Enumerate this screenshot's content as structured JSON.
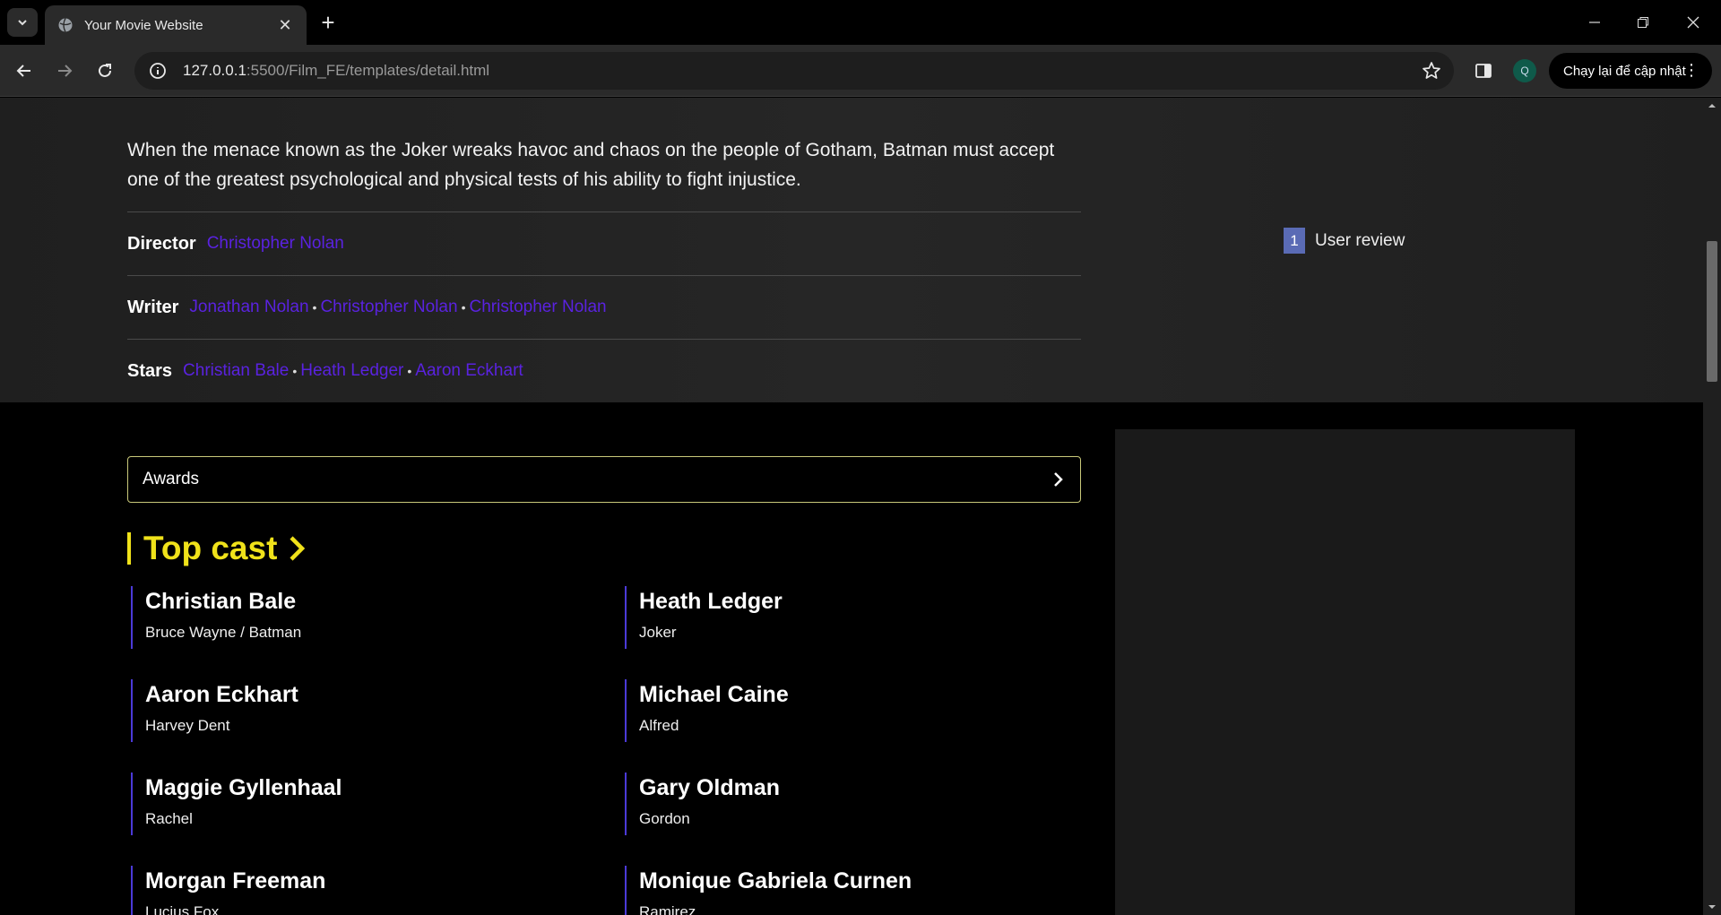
{
  "browser": {
    "tab_title": "Your Movie Website",
    "url_host": "127.0.0.1",
    "url_path": ":5500/Film_FE/templates/detail.html",
    "update_label": "Chạy lại để cập nhật",
    "profile_initial": "Q"
  },
  "movie": {
    "plot": "When the menace known as the Joker wreaks havoc and chaos on the people of Gotham, Batman must accept one of the greatest psychological and physical tests of his ability to fight injustice.",
    "director_label": "Director",
    "directors": [
      "Christopher Nolan"
    ],
    "writer_label": "Writer",
    "writers": [
      "Jonathan Nolan",
      "Christopher Nolan",
      "Christopher Nolan"
    ],
    "stars_label": "Stars",
    "stars": [
      "Christian Bale",
      "Heath Ledger",
      "Aaron Eckhart"
    ],
    "separator": "•"
  },
  "reviews": {
    "count": "1",
    "label": "User review"
  },
  "awards": {
    "label": "Awards"
  },
  "top_cast": {
    "title": "Top cast",
    "members": [
      {
        "name": "Christian Bale",
        "role": "Bruce Wayne / Batman"
      },
      {
        "name": "Heath Ledger",
        "role": "Joker"
      },
      {
        "name": "Aaron Eckhart",
        "role": "Harvey Dent"
      },
      {
        "name": "Michael Caine",
        "role": "Alfred"
      },
      {
        "name": "Maggie Gyllenhaal",
        "role": "Rachel"
      },
      {
        "name": "Gary Oldman",
        "role": "Gordon"
      },
      {
        "name": "Morgan Freeman",
        "role": "Lucius Fox"
      },
      {
        "name": "Monique Gabriela Curnen",
        "role": "Ramirez"
      }
    ]
  },
  "colors": {
    "accent_yellow": "#f0e21a",
    "link_purple": "#5a22e0",
    "cast_border": "#4b3ad8",
    "review_badge": "#5a6bb5"
  }
}
